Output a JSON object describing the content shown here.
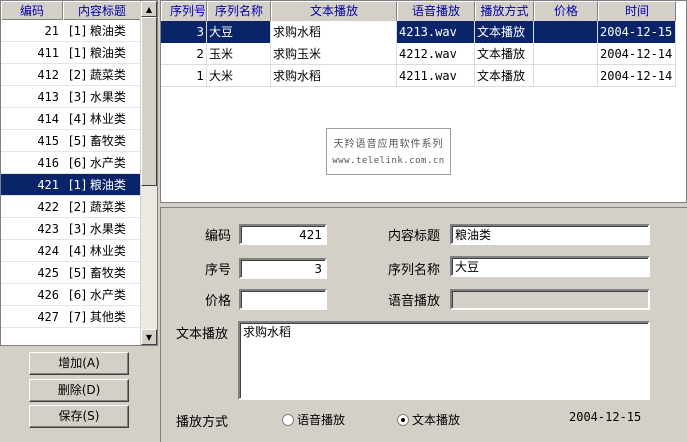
{
  "left_list": {
    "headers": [
      "编码",
      "内容标题"
    ],
    "rows": [
      {
        "code": "21",
        "title": "[1] 粮油类"
      },
      {
        "code": "411",
        "title": "[1] 粮油类"
      },
      {
        "code": "412",
        "title": "[2] 蔬菜类"
      },
      {
        "code": "413",
        "title": "[3] 水果类"
      },
      {
        "code": "414",
        "title": "[4] 林业类"
      },
      {
        "code": "415",
        "title": "[5] 畜牧类"
      },
      {
        "code": "416",
        "title": "[6] 水产类"
      },
      {
        "code": "421",
        "title": "[1] 粮油类"
      },
      {
        "code": "422",
        "title": "[2] 蔬菜类"
      },
      {
        "code": "423",
        "title": "[3] 水果类"
      },
      {
        "code": "424",
        "title": "[4] 林业类"
      },
      {
        "code": "425",
        "title": "[5] 畜牧类"
      },
      {
        "code": "426",
        "title": "[6] 水产类"
      },
      {
        "code": "427",
        "title": "[7] 其他类"
      }
    ],
    "selected_code": "421"
  },
  "buttons": {
    "add": "增加(A)",
    "delete": "删除(D)",
    "save": "保存(S)"
  },
  "grid": {
    "headers": [
      "序列号",
      "序列名称",
      "文本播放",
      "语音播放",
      "播放方式",
      "价格",
      "时间"
    ],
    "rows": [
      [
        "3",
        "大豆",
        "求购水稻",
        "4213.wav",
        "文本播放",
        "",
        "2004-12-15"
      ],
      [
        "2",
        "玉米",
        "求购玉米",
        "4212.wav",
        "文本播放",
        "",
        "2004-12-14"
      ],
      [
        "1",
        "大米",
        "求购水稻",
        "4211.wav",
        "文本播放",
        "",
        "2004-12-14"
      ]
    ]
  },
  "watermark": {
    "line1": "天羚语音应用软件系列",
    "line2": "www.telelink.com.cn"
  },
  "form": {
    "code_label": "编码",
    "code_value": "421",
    "content_title_label": "内容标题",
    "content_title_value": "粮油类",
    "seq_label": "序号",
    "seq_value": "3",
    "seq_name_label": "序列名称",
    "seq_name_value": "大豆",
    "price_label": "价格",
    "price_value": "",
    "voice_label": "语音播放",
    "voice_value": "",
    "text_label": "文本播放",
    "text_value": "求购水稻",
    "mode_label": "播放方式",
    "radio_voice": "语音播放",
    "radio_text": "文本播放",
    "selected_mode": "文本播放",
    "date": "2004-12-15"
  },
  "colors": {
    "selection": "#0a246a",
    "header_text": "#0000a8",
    "face": "#d4d0c8"
  }
}
